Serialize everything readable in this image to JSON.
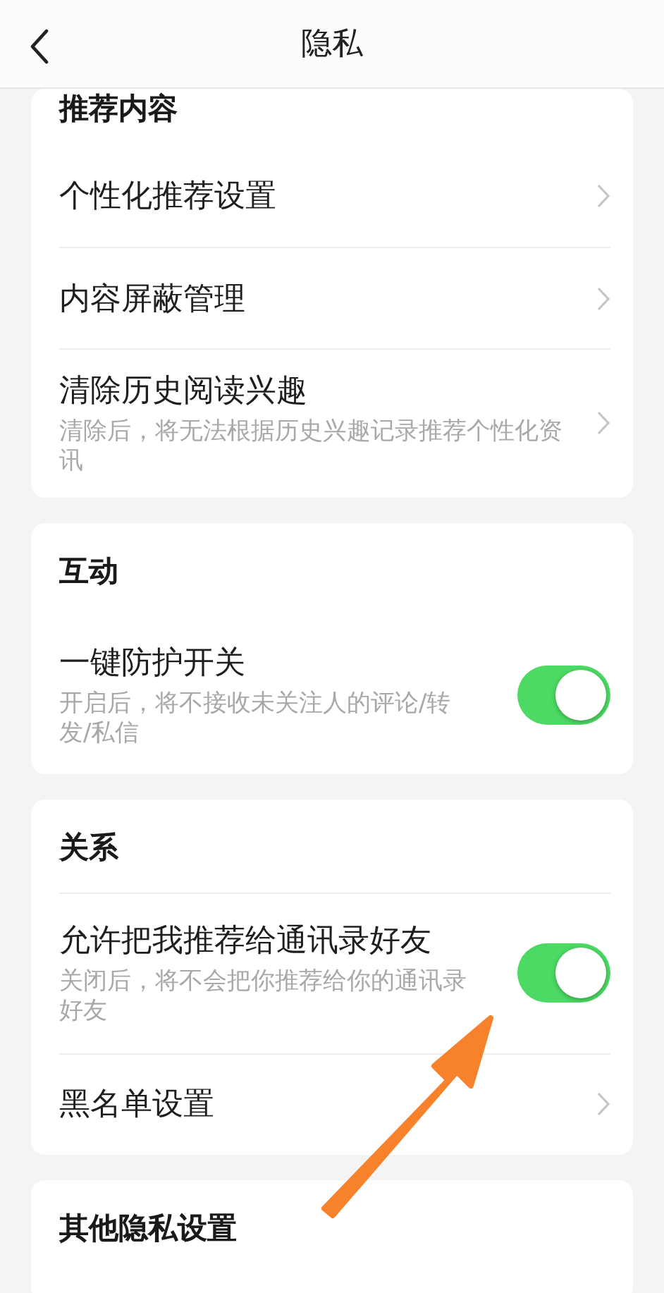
{
  "header": {
    "title": "隐私"
  },
  "sections": [
    {
      "title": "推荐内容",
      "title_divider": false,
      "items": [
        {
          "kind": "link",
          "label": "个性化推荐设置"
        },
        {
          "kind": "link",
          "label": "内容屏蔽管理"
        },
        {
          "kind": "link",
          "label": "清除历史阅读兴趣",
          "description": "清除后，将无法根据历史兴趣记录推荐个性化资讯"
        }
      ]
    },
    {
      "title": "互动",
      "title_divider": false,
      "items": [
        {
          "kind": "toggle",
          "label": "一键防护开关",
          "description": "开启后，将不接收未关注人的评论/转发/私信",
          "on": true
        }
      ]
    },
    {
      "title": "关系",
      "title_divider": true,
      "items": [
        {
          "kind": "toggle",
          "label": "允许把我推荐给通讯录好友",
          "description": "关闭后，将不会把你推荐给你的通讯录好友",
          "on": true
        },
        {
          "kind": "link",
          "label": "黑名单设置"
        }
      ]
    },
    {
      "title": "其他隐私设置",
      "title_divider": false
    }
  ]
}
